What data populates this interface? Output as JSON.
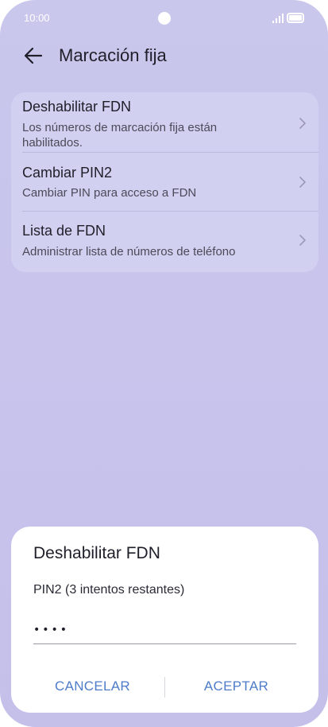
{
  "status_bar": {
    "time": "10:00"
  },
  "header": {
    "title": "Marcación fija",
    "back_icon": "arrow-left-icon"
  },
  "settings": {
    "items": [
      {
        "title": "Deshabilitar FDN",
        "subtitle": "Los números de marcación fija están habilitados."
      },
      {
        "title": "Cambiar PIN2",
        "subtitle": "Cambiar PIN para acceso a FDN"
      },
      {
        "title": "Lista de FDN",
        "subtitle": "Administrar lista de números de teléfono"
      }
    ]
  },
  "dialog": {
    "title": "Deshabilitar FDN",
    "label": "PIN2 (3 intentos restantes)",
    "pin_value": "••••",
    "cancel_label": "CANCELAR",
    "accept_label": "ACEPTAR"
  },
  "colors": {
    "accent": "#4f7cc9",
    "background": "#c8c4ec",
    "card": "#d6d4f2"
  }
}
